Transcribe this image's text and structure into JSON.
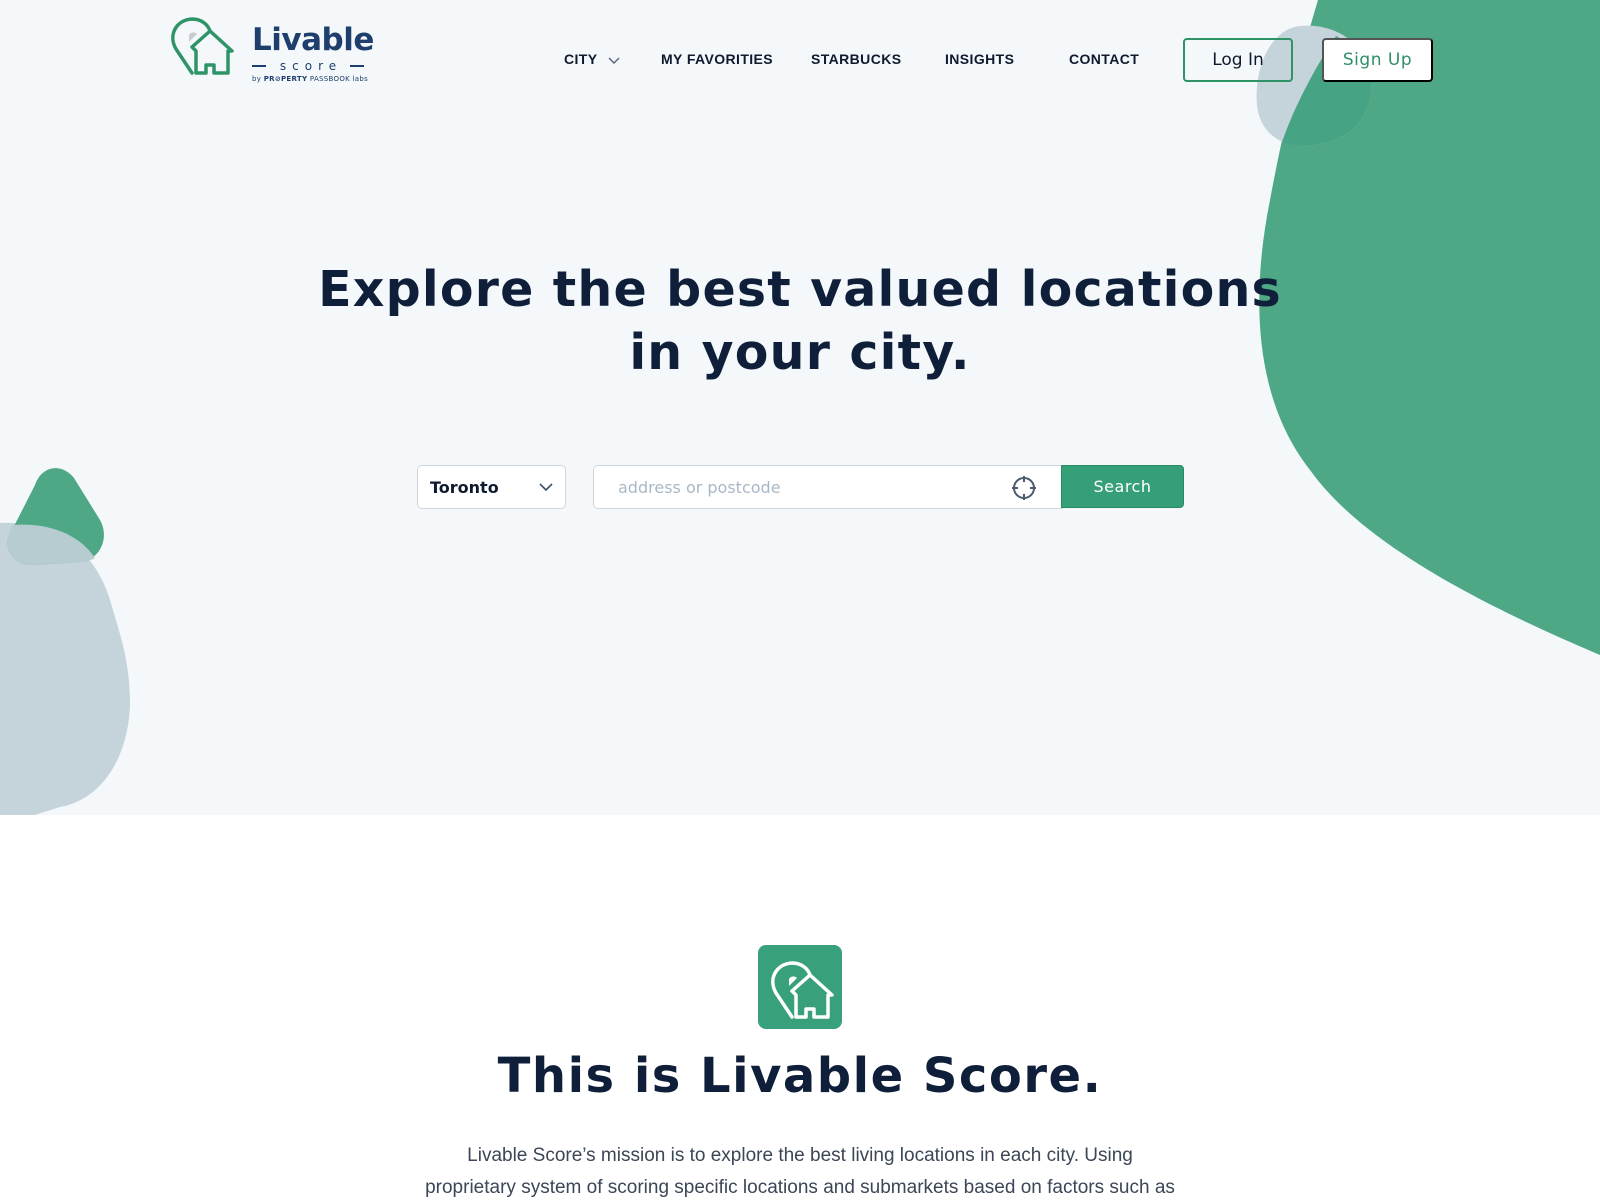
{
  "brand": {
    "name": "Livable",
    "sub": "score",
    "by_prefix": "by",
    "by_bold": "PR⊘PERTY",
    "by_rest": "PASSBOOK labs"
  },
  "nav": {
    "items": [
      {
        "label": "CITY",
        "has_dropdown": true
      },
      {
        "label": "MY FAVORITIES"
      },
      {
        "label": "STARBUCKS"
      },
      {
        "label": "INSIGHTS"
      },
      {
        "label": "CONTACT"
      }
    ],
    "login_label": "Log In",
    "signup_label": "Sign Up"
  },
  "hero": {
    "title_line1": "Explore the best valued locations",
    "title_line2": "in your city.",
    "city_select": {
      "selected": "Toronto"
    },
    "search": {
      "value": "",
      "placeholder": "address or postcode",
      "button_label": "Search"
    }
  },
  "about": {
    "title": "This is Livable Score.",
    "text_line1": "Livable Score’s mission is to explore the best living locations in each city.  Using",
    "text_line2": "proprietary system of scoring specific locations and submarkets based on factors such as"
  },
  "colors": {
    "accent_green": "#35a077",
    "blob_green": "#4ea886",
    "blob_gray": "#c5d3db",
    "hero_bg": "#f4f8fb",
    "heading": "#0f1f3a",
    "brand_navy": "#1e3f6e"
  }
}
